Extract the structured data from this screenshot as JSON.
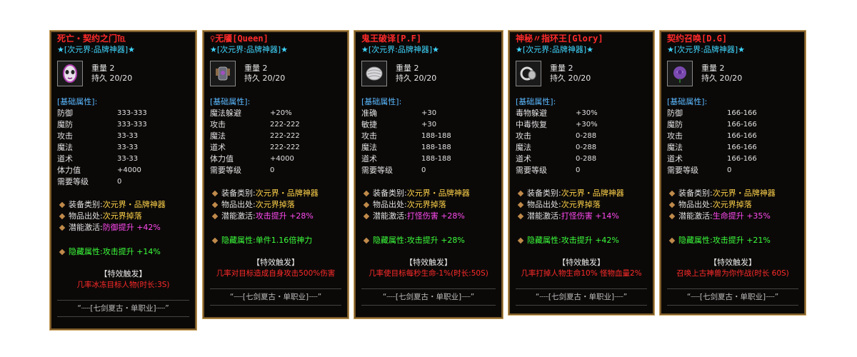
{
  "cards": [
    {
      "title": "死亡・契约之门℡",
      "subtitle": "★[次元界:品牌神器]★",
      "icon": "mask-icon",
      "weight": "重量 2",
      "durability": "持久 20/20",
      "base_title": "[基础属性]:",
      "stats": [
        {
          "k": "防御",
          "v": "333-333"
        },
        {
          "k": "魔防",
          "v": "333-333"
        },
        {
          "k": "攻击",
          "v": "33-33"
        },
        {
          "k": "魔法",
          "v": "33-33"
        },
        {
          "k": "道术",
          "v": "33-33"
        },
        {
          "k": "体力值",
          "v": "+4000"
        },
        {
          "k": "需要等级",
          "v": "0"
        }
      ],
      "info": {
        "category_label": "装备类别:",
        "category": "次元界・品牌神器",
        "source_label": "物品出处:",
        "source": "次元界掉落",
        "potential_label": "潜能激活:",
        "potential": "防御提升 +42%"
      },
      "hidden_label": "隐藏属性:",
      "hidden": "攻击提升 +14%",
      "trigger_title": "【特效触发】",
      "trigger_text": "几率冰冻目标人物(时长:3S)",
      "footer": "“┈┈[七剑夏古・单职业]┈┈”"
    },
    {
      "title": "♀无餍[Queen]",
      "subtitle": "★[次元界:品牌神器]★",
      "icon": "armor-icon",
      "weight": "重量 2",
      "durability": "持久 20/20",
      "base_title": "[基础属性]:",
      "stats": [
        {
          "k": "魔法躲避",
          "v": "+20%"
        },
        {
          "k": "攻击",
          "v": "222-222"
        },
        {
          "k": "魔法",
          "v": "222-222"
        },
        {
          "k": "道术",
          "v": "222-222"
        },
        {
          "k": "体力值",
          "v": "+4000"
        },
        {
          "k": "需要等级",
          "v": "0"
        }
      ],
      "info": {
        "category_label": "装备类别:",
        "category": "次元界・品牌神器",
        "source_label": "物品出处:",
        "source": "次元界掉落",
        "potential_label": "潜能激活:",
        "potential": "攻击提升 +28%"
      },
      "hidden_label": "隐藏属性:",
      "hidden": "单件1.16倍神力",
      "trigger_title": "【特效触发】",
      "trigger_text": "几率对目标造成自身攻击500%伤害",
      "footer": "“┈┈[七剑夏古・单职业]┈┈”"
    },
    {
      "title": "鬼王破译[P.F]",
      "subtitle": "★[次元界:品牌神器]★",
      "icon": "bandage-icon",
      "weight": "重量 2",
      "durability": "持久 20/20",
      "base_title": "[基础属性]:",
      "stats": [
        {
          "k": "准确",
          "v": "+30"
        },
        {
          "k": "敏捷",
          "v": "+30"
        },
        {
          "k": "攻击",
          "v": "188-188"
        },
        {
          "k": "魔法",
          "v": "188-188"
        },
        {
          "k": "道术",
          "v": "188-188"
        },
        {
          "k": "需要等级",
          "v": "0"
        }
      ],
      "info": {
        "category_label": "装备类别:",
        "category": "次元界・品牌神器",
        "source_label": "物品出处:",
        "source": "次元界掉落",
        "potential_label": "潜能激活:",
        "potential": "打怪伤害 +28%"
      },
      "hidden_label": "隐藏属性:",
      "hidden": "攻击提升 +28%",
      "trigger_title": "【特效触发】",
      "trigger_text": "几率使目标每秒生命-1%(时长:50S)",
      "footer": "“┈┈[七剑夏古・单职业]┈┈”"
    },
    {
      "title": "神秘〃指环王[Glory]",
      "subtitle": "★[次元界:品牌神器]★",
      "icon": "ring-icon",
      "weight": "重量 2",
      "durability": "持久 20/20",
      "base_title": "[基础属性]:",
      "stats": [
        {
          "k": "毒物躲避",
          "v": "+30%"
        },
        {
          "k": "中毒恢复",
          "v": "+30%"
        },
        {
          "k": "攻击",
          "v": "0-288"
        },
        {
          "k": "魔法",
          "v": "0-288"
        },
        {
          "k": "道术",
          "v": "0-288"
        },
        {
          "k": "需要等级",
          "v": "0"
        }
      ],
      "info": {
        "category_label": "装备类别:",
        "category": "次元界・品牌神器",
        "source_label": "物品出处:",
        "source": "次元界掉落",
        "potential_label": "潜能激活:",
        "potential": "打怪伤害 +14%"
      },
      "hidden_label": "隐藏属性:",
      "hidden": "攻击提升 +42%",
      "trigger_title": "【特效触发】",
      "trigger_text": "几率打掉人物生命10% 怪物血量2%",
      "footer": "“┈┈[七剑夏古・单职业]┈┈”"
    },
    {
      "title": "契约召唤[D.G]",
      "subtitle": "★[次元界:品牌神器]★",
      "icon": "rose-icon",
      "weight": "重量 2",
      "durability": "持久 20/20",
      "base_title": "[基础属性]:",
      "stats": [
        {
          "k": "防御",
          "v": "166-166"
        },
        {
          "k": "魔防",
          "v": "166-166"
        },
        {
          "k": "攻击",
          "v": "166-166"
        },
        {
          "k": "魔法",
          "v": "166-166"
        },
        {
          "k": "道术",
          "v": "166-166"
        },
        {
          "k": "需要等级",
          "v": "0"
        }
      ],
      "info": {
        "category_label": "装备类别:",
        "category": "次元界・品牌神器",
        "source_label": "物品出处:",
        "source": "次元界掉落",
        "potential_label": "潜能激活:",
        "potential": "生命提升 +35%"
      },
      "hidden_label": "隐藏属性:",
      "hidden": "攻击提升 +21%",
      "trigger_title": "【特效触发】",
      "trigger_text": "召唤上古神兽为你作战(时长 60S)",
      "footer": "“┈┈[七剑夏古・单职业]┈┈”"
    }
  ]
}
